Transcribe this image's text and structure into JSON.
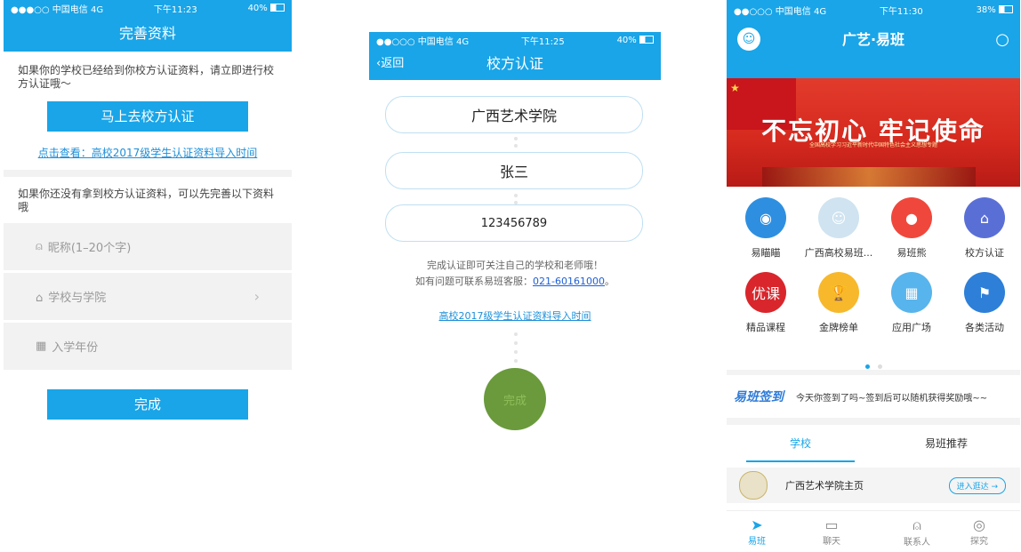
{
  "phone1": {
    "status": {
      "left": "●●●○○ 中国电信  4G",
      "time": "下午11:23",
      "battery": "40%"
    },
    "title": "完善资料",
    "intro": "如果你的学校已经给到你校方认证资料，请立即进行校方认证哦～",
    "auth_button": "马上去校方认证",
    "link": "点击查看：高校2017级学生认证资料导入时间",
    "intro2": "如果你还没有拿到校方认证资料，可以先完善以下资料哦",
    "fields": {
      "nickname": "昵称(1–20个字)",
      "school": "学校与学院",
      "year": "入学年份"
    },
    "done_button": "完成"
  },
  "phone2": {
    "status": {
      "left": "●●○○○ 中国电信  4G",
      "time": "下午11:25",
      "battery": "40%"
    },
    "back": "返回",
    "title": "校方认证",
    "school_value": "广西艺术学院",
    "name_value": "张三",
    "id_value": "123456789",
    "note_line1": "完成认证即可关注自己的学校和老师哦！",
    "note_line2_prefix": "如有问题可联系易班客服：",
    "phone_number": "021-60161000",
    "note_line2_suffix": "。",
    "link": "高校2017级学生认证资料导入时间",
    "submit": "完成"
  },
  "phone3": {
    "status": {
      "left": "●●○○○ 中国电信  4G",
      "time": "下午11:30",
      "battery": "38%"
    },
    "title": "广艺·易班",
    "banner": {
      "headline": "不忘初心 牢记使命",
      "subline": "全国高校学习习近平新时代中国特色社会主义思想专题"
    },
    "grid": [
      {
        "label": "易瞄瞄",
        "color": "#2e8fe0",
        "glyph": "◉"
      },
      {
        "label": "广西高校易班...",
        "color": "#cfe3f0",
        "glyph": "☺"
      },
      {
        "label": "易班熊",
        "color": "#f0473c",
        "glyph": "●"
      },
      {
        "label": "校方认证",
        "color": "#5a6fd6",
        "glyph": "⌂"
      },
      {
        "label": "精品课程",
        "color": "#d8262c",
        "glyph": "优课"
      },
      {
        "label": "金牌榜单",
        "color": "#f7b82c",
        "glyph": "🏆"
      },
      {
        "label": "应用广场",
        "color": "#58b4ec",
        "glyph": "▦"
      },
      {
        "label": "各类活动",
        "color": "#2d7fd8",
        "glyph": "⚑"
      }
    ],
    "signin_logo": "易班签到",
    "signin_text": "今天你签到了吗~签到后可以随机获得奖励哦~~",
    "tabs": {
      "school": "学校",
      "recommend": "易班推荐"
    },
    "school_row": {
      "name": "广西艺术学院主页",
      "enter": "进入逛达 →"
    },
    "bottom_tabs": [
      "易班",
      "聊天",
      "联系人",
      "探究"
    ]
  }
}
